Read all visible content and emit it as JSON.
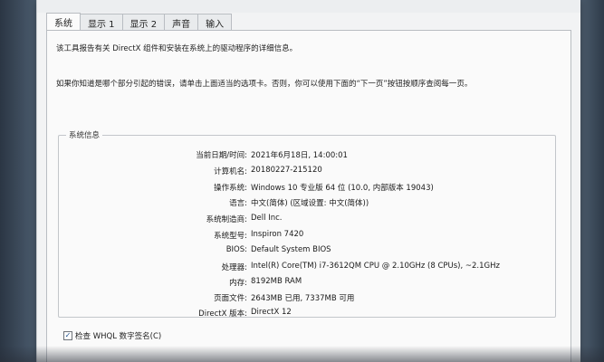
{
  "tabs": [
    {
      "label": "系统",
      "active": true
    },
    {
      "label": "显示 1",
      "active": false
    },
    {
      "label": "显示 2",
      "active": false
    },
    {
      "label": "声音",
      "active": false
    },
    {
      "label": "输入",
      "active": false
    }
  ],
  "intro": {
    "line1": "该工具报告有关 DirectX 组件和安装在系统上的驱动程序的详细信息。",
    "line2": "如果你知道是哪个部分引起的错误，请单击上面适当的选项卡。否则，你可以使用下面的“下一页”按钮按顺序查阅每一页。"
  },
  "system_info": {
    "title": "系统信息",
    "rows": [
      {
        "label": "当前日期/时间:",
        "value": "2021年6月18日, 14:00:01"
      },
      {
        "label": "计算机名:",
        "value": "20180227-215120"
      },
      {
        "label": "操作系统:",
        "value": "Windows 10 专业版 64 位 (10.0, 内部版本 19043)"
      },
      {
        "label": "语言:",
        "value": "中文(简体) (区域设置: 中文(简体))"
      },
      {
        "label": "系统制造商:",
        "value": "Dell Inc."
      },
      {
        "label": "系统型号:",
        "value": "Inspiron 7420"
      },
      {
        "label": "BIOS:",
        "value": "Default System BIOS"
      },
      {
        "label": "处理器:",
        "value": "Intel(R) Core(TM) i7-3612QM CPU @ 2.10GHz (8 CPUs), ~2.1GHz"
      },
      {
        "label": "内存:",
        "value": "8192MB RAM"
      },
      {
        "label": "页面文件:",
        "value": "2643MB 已用, 7337MB 可用"
      },
      {
        "label": "DirectX 版本:",
        "value": "DirectX 12"
      }
    ]
  },
  "whql": {
    "label": "检查 WHQL 数字签名(C)",
    "checked": true
  }
}
